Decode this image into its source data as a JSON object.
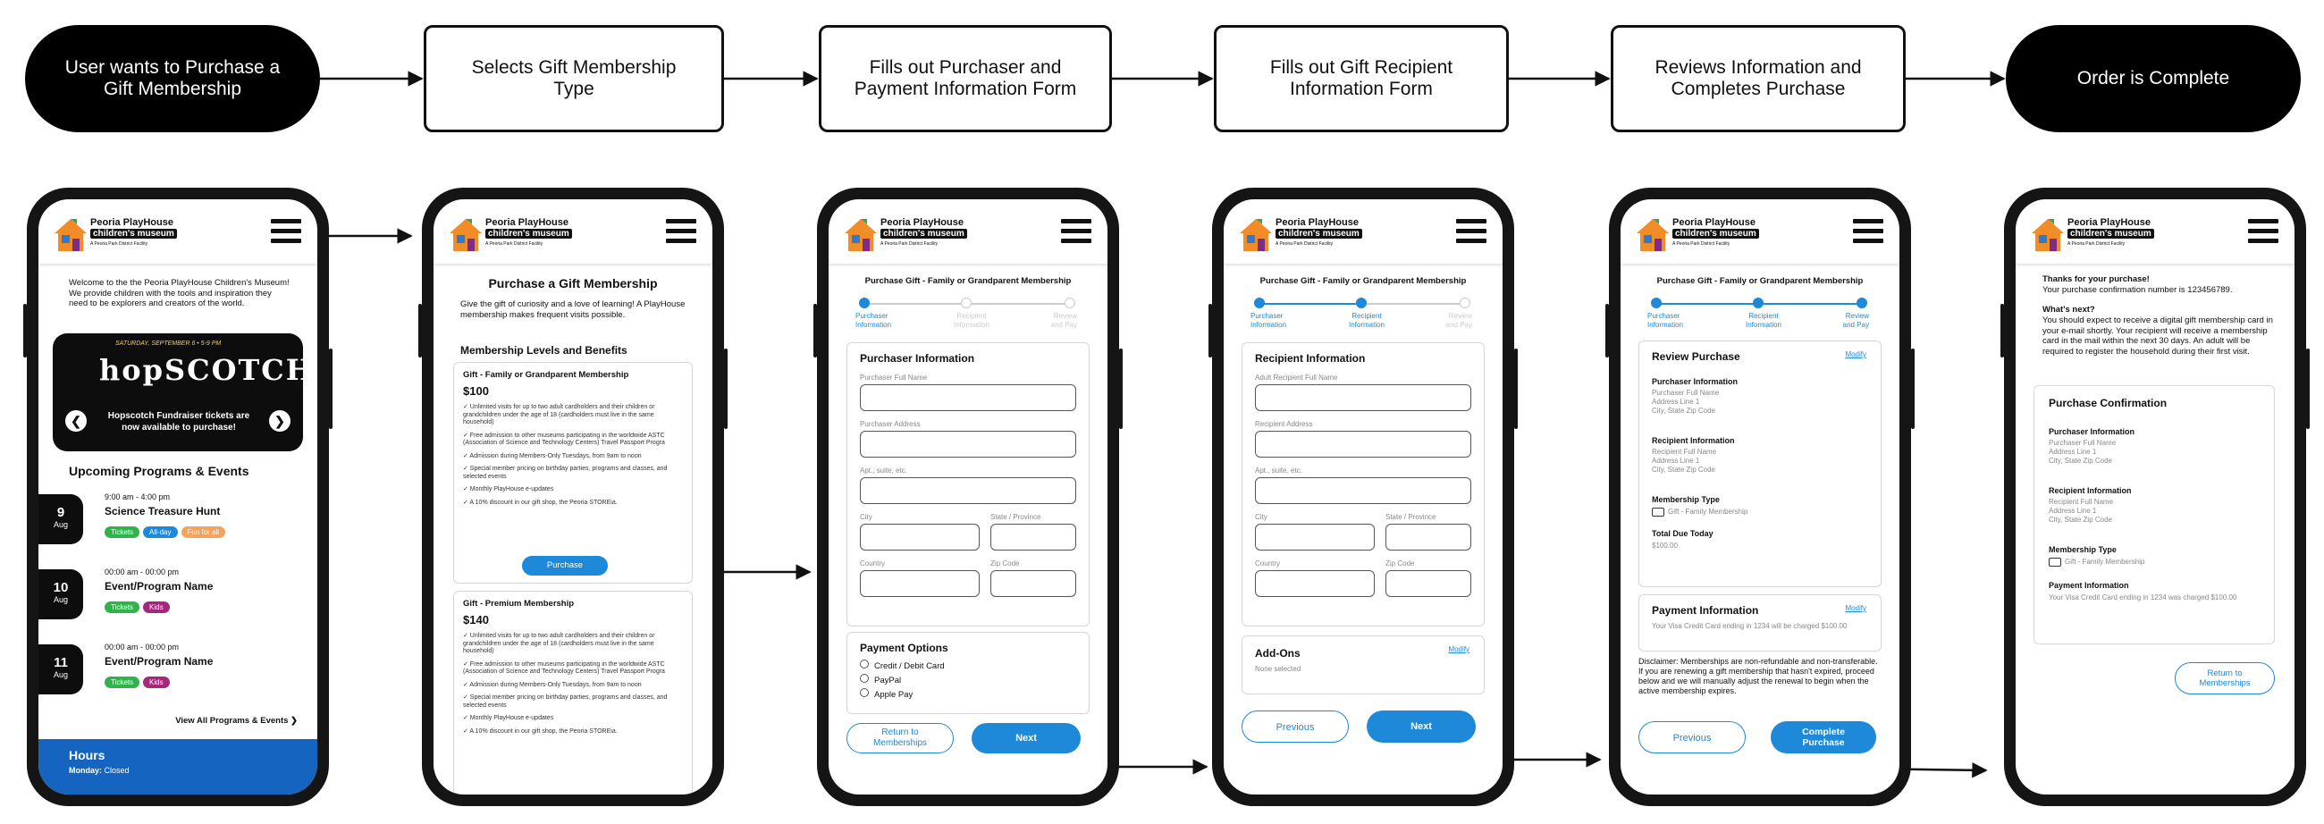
{
  "flow": {
    "steps": [
      {
        "text": "User wants to Purchase a Gift Membership",
        "style": "terminal"
      },
      {
        "text": "Selects Gift Membership Type",
        "style": "process"
      },
      {
        "text": "Fills out Purchaser and Payment Information Form",
        "style": "process"
      },
      {
        "text": "Fills out Gift Recipient Information Form",
        "style": "process"
      },
      {
        "text": "Reviews Information and Completes Purchase",
        "style": "process"
      },
      {
        "text": "Order is Complete",
        "style": "terminal"
      }
    ]
  },
  "brand": {
    "name": "Peoria PlayHouse",
    "sub": "children's museum",
    "tag": "A Peoria Park District Facility"
  },
  "colors": {
    "accent": "#1e88d9",
    "hours_bg": "#1565c0",
    "tag_tickets": "#2fb34a",
    "tag_allday": "#1e88d9",
    "tag_funforall": "#f5a25d",
    "tag_kids": "#a3287c"
  },
  "screen1": {
    "welcome": "Welcome to the the Peoria PlayHouse Children's Museum! We provide children with the tools and inspiration they need to be explorers and creators of the world.",
    "banner_top": "SATURDAY, SEPTEMBER 6 • 5-9 PM",
    "banner_logo": "hopSCOTCH",
    "banner_text": "Hopscotch Fundraiser tickets are now available to purchase!",
    "programs_title": "Upcoming Programs & Events",
    "events": [
      {
        "day": "9",
        "month": "Aug",
        "time": "9:00 am - 4:00 pm",
        "title": "Science Treasure Hunt",
        "tags": [
          "Tickets",
          "All-day",
          "Fun for all"
        ]
      },
      {
        "day": "10",
        "month": "Aug",
        "time": "00:00 am - 00:00 pm",
        "title": "Event/Program Name",
        "tags": [
          "Tickets",
          "Kids"
        ]
      },
      {
        "day": "11",
        "month": "Aug",
        "time": "00:00 am - 00:00 pm",
        "title": "Event/Program Name",
        "tags": [
          "Tickets",
          "Kids"
        ]
      }
    ],
    "view_all": "View All Programs & Events ❯",
    "hours_title": "Hours",
    "hours_monday_label": "Monday:",
    "hours_monday_value": "Closed"
  },
  "screen2": {
    "title": "Purchase a Gift Membership",
    "intro": "Give the gift of curiosity and a love of learning! A PlayHouse membership makes frequent visits possible.",
    "levels_title": "Membership Levels and Benefits",
    "plans": [
      {
        "name": "Gift - Family or Grandparent Membership",
        "price": "$100",
        "benefits": [
          "✓ Unlimited visits for up to two adult cardholders and their children or grandchildren under the age of 18 (cardholders must live in the same household)",
          "✓ Free admission to other museums participating in the worldwide ASTC (Association of Science and Technology Centers) Travel Passport Progra",
          "✓ Admission during Members-Only Tuesdays, from 9am to noon",
          "✓ Special member pricing on birthday parties, programs and classes, and selected events",
          "✓ Monthly PlayHouse e-updates",
          "✓ A 10% discount in our gift shop, the Peoria STOREia."
        ],
        "button": "Purchase"
      },
      {
        "name": "Gift - Premium Membership",
        "price": "$140",
        "benefits": [
          "✓ Unlimited visits for up to two adult cardholders and their children or grandchildren under the age of 18 (cardholders must live in the same household)",
          "✓ Free admission to other museums participating in the worldwide ASTC (Association of Science and Technology Centers) Travel Passport Progra",
          "✓ Admission during Members-Only Tuesdays, from 9am to noon",
          "✓ Special member pricing on birthday parties, programs and classes, and selected events",
          "✓ Monthly PlayHouse e-updates",
          "✓ A 10% discount in our gift shop, the Peoria STOREia."
        ]
      }
    ]
  },
  "form_title": "Purchase Gift - Family or Grandparent Membership",
  "stepper_labels": [
    "Purchaser Information",
    "Recipient Information",
    "Review and Pay"
  ],
  "screen3": {
    "section": "Purchaser Information",
    "full_name": "Purchaser Full Name",
    "address": "Purchaser Address",
    "apt": "Apt., suite, etc.",
    "city": "City",
    "state": "State / Province",
    "country": "Country",
    "zip": "Zip Code",
    "payment_title": "Payment Options",
    "payment_options": [
      "Credit / Debit Card",
      "PayPal",
      "Apple Pay"
    ],
    "return_button": "Return to Memberships",
    "next_button": "Next"
  },
  "screen4": {
    "section": "Recipient Information",
    "full_name": "Adult Recipient Full Name",
    "address": "Recipient Address",
    "apt": "Apt., suite, etc.",
    "city": "City",
    "state": "State / Province",
    "country": "Country",
    "zip": "Zip Code",
    "addons_title": "Add-Ons",
    "addons_value": "None selected",
    "modify": "Modify",
    "previous_button": "Previous",
    "next_button": "Next"
  },
  "screen5": {
    "review_title": "Review Purchase",
    "modify": "Modify",
    "purchaser_title": "Purchaser Information",
    "purchaser_lines": [
      "Purchaser Full Name",
      "Address Line 1",
      "City, State Zip Code"
    ],
    "recipient_title": "Recipient Information",
    "recipient_lines": [
      "Recipient Full Name",
      "Address Line 1",
      "City, State Zip Code"
    ],
    "type_title": "Membership Type",
    "type_value": "Gift - Family Membership",
    "total_title": "Total Due Today",
    "total_value": "$100.00",
    "payment_title": "Payment Information",
    "payment_text": "Your Visa Credit Card ending in 1234 will be charged $100.00",
    "disclaimer": "Disclaimer: Memberships are non-refundable and non-transferable. If you are renewing a gift membership that hasn't expired, proceed below and we will manually adjust the renewal to begin when the active membership expires.",
    "previous_button": "Previous",
    "complete_button": "Complete Purchase"
  },
  "screen6": {
    "thanks": "Thanks for your purchase!",
    "confirmation": "Your purchase confirmation number is 123456789.",
    "next_title": "What's next?",
    "next_text": "You should expect to receive a digital gift membership card in your e-mail shortly. Your recipient will receive a membership card in the mail within the next 30 days. An adult will be required to register the household during their first visit.",
    "card_title": "Purchase Confirmation",
    "purchaser_title": "Purchaser Information",
    "purchaser_lines": [
      "Purchaser Full Name",
      "Address Line 1",
      "City, State Zip Code"
    ],
    "recipient_title": "Recipient Information",
    "recipient_lines": [
      "Recipient Full Name",
      "Address Line 1",
      "City, State Zip Code"
    ],
    "type_title": "Membership Type",
    "type_value": "Gift - Family Membership",
    "payment_title": "Payment Information",
    "payment_text": "Your Visa Credit Card ending in 1234 was charged $100.00",
    "return_button": "Return to Memberships"
  }
}
